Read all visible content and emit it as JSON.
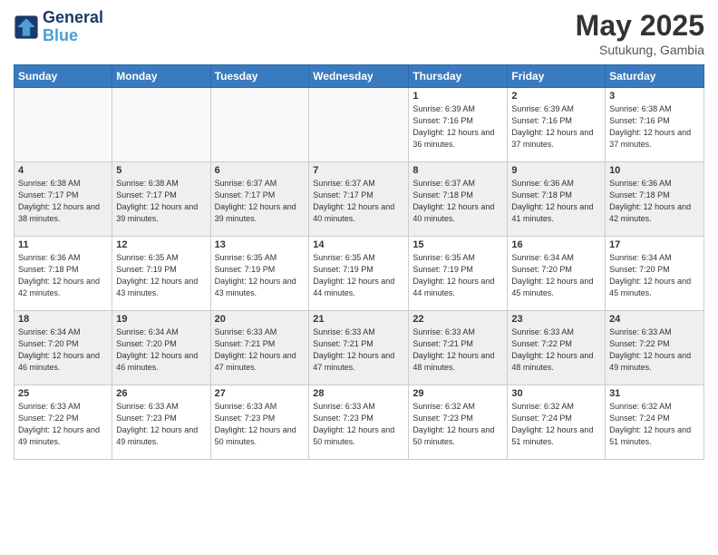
{
  "logo": {
    "line1": "General",
    "line2": "Blue"
  },
  "title": {
    "month": "May 2025",
    "location": "Sutukung, Gambia"
  },
  "weekdays": [
    "Sunday",
    "Monday",
    "Tuesday",
    "Wednesday",
    "Thursday",
    "Friday",
    "Saturday"
  ],
  "weeks": [
    [
      {
        "day": "",
        "sunrise": "",
        "sunset": "",
        "daylight": "",
        "empty": true
      },
      {
        "day": "",
        "sunrise": "",
        "sunset": "",
        "daylight": "",
        "empty": true
      },
      {
        "day": "",
        "sunrise": "",
        "sunset": "",
        "daylight": "",
        "empty": true
      },
      {
        "day": "",
        "sunrise": "",
        "sunset": "",
        "daylight": "",
        "empty": true
      },
      {
        "day": "1",
        "sunrise": "6:39 AM",
        "sunset": "7:16 PM",
        "daylight": "12 hours and 36 minutes."
      },
      {
        "day": "2",
        "sunrise": "6:39 AM",
        "sunset": "7:16 PM",
        "daylight": "12 hours and 37 minutes."
      },
      {
        "day": "3",
        "sunrise": "6:38 AM",
        "sunset": "7:16 PM",
        "daylight": "12 hours and 37 minutes."
      }
    ],
    [
      {
        "day": "4",
        "sunrise": "6:38 AM",
        "sunset": "7:17 PM",
        "daylight": "12 hours and 38 minutes."
      },
      {
        "day": "5",
        "sunrise": "6:38 AM",
        "sunset": "7:17 PM",
        "daylight": "12 hours and 39 minutes."
      },
      {
        "day": "6",
        "sunrise": "6:37 AM",
        "sunset": "7:17 PM",
        "daylight": "12 hours and 39 minutes."
      },
      {
        "day": "7",
        "sunrise": "6:37 AM",
        "sunset": "7:17 PM",
        "daylight": "12 hours and 40 minutes."
      },
      {
        "day": "8",
        "sunrise": "6:37 AM",
        "sunset": "7:18 PM",
        "daylight": "12 hours and 40 minutes."
      },
      {
        "day": "9",
        "sunrise": "6:36 AM",
        "sunset": "7:18 PM",
        "daylight": "12 hours and 41 minutes."
      },
      {
        "day": "10",
        "sunrise": "6:36 AM",
        "sunset": "7:18 PM",
        "daylight": "12 hours and 42 minutes."
      }
    ],
    [
      {
        "day": "11",
        "sunrise": "6:36 AM",
        "sunset": "7:18 PM",
        "daylight": "12 hours and 42 minutes."
      },
      {
        "day": "12",
        "sunrise": "6:35 AM",
        "sunset": "7:19 PM",
        "daylight": "12 hours and 43 minutes."
      },
      {
        "day": "13",
        "sunrise": "6:35 AM",
        "sunset": "7:19 PM",
        "daylight": "12 hours and 43 minutes."
      },
      {
        "day": "14",
        "sunrise": "6:35 AM",
        "sunset": "7:19 PM",
        "daylight": "12 hours and 44 minutes."
      },
      {
        "day": "15",
        "sunrise": "6:35 AM",
        "sunset": "7:19 PM",
        "daylight": "12 hours and 44 minutes."
      },
      {
        "day": "16",
        "sunrise": "6:34 AM",
        "sunset": "7:20 PM",
        "daylight": "12 hours and 45 minutes."
      },
      {
        "day": "17",
        "sunrise": "6:34 AM",
        "sunset": "7:20 PM",
        "daylight": "12 hours and 45 minutes."
      }
    ],
    [
      {
        "day": "18",
        "sunrise": "6:34 AM",
        "sunset": "7:20 PM",
        "daylight": "12 hours and 46 minutes."
      },
      {
        "day": "19",
        "sunrise": "6:34 AM",
        "sunset": "7:20 PM",
        "daylight": "12 hours and 46 minutes."
      },
      {
        "day": "20",
        "sunrise": "6:33 AM",
        "sunset": "7:21 PM",
        "daylight": "12 hours and 47 minutes."
      },
      {
        "day": "21",
        "sunrise": "6:33 AM",
        "sunset": "7:21 PM",
        "daylight": "12 hours and 47 minutes."
      },
      {
        "day": "22",
        "sunrise": "6:33 AM",
        "sunset": "7:21 PM",
        "daylight": "12 hours and 48 minutes."
      },
      {
        "day": "23",
        "sunrise": "6:33 AM",
        "sunset": "7:22 PM",
        "daylight": "12 hours and 48 minutes."
      },
      {
        "day": "24",
        "sunrise": "6:33 AM",
        "sunset": "7:22 PM",
        "daylight": "12 hours and 49 minutes."
      }
    ],
    [
      {
        "day": "25",
        "sunrise": "6:33 AM",
        "sunset": "7:22 PM",
        "daylight": "12 hours and 49 minutes."
      },
      {
        "day": "26",
        "sunrise": "6:33 AM",
        "sunset": "7:23 PM",
        "daylight": "12 hours and 49 minutes."
      },
      {
        "day": "27",
        "sunrise": "6:33 AM",
        "sunset": "7:23 PM",
        "daylight": "12 hours and 50 minutes."
      },
      {
        "day": "28",
        "sunrise": "6:33 AM",
        "sunset": "7:23 PM",
        "daylight": "12 hours and 50 minutes."
      },
      {
        "day": "29",
        "sunrise": "6:32 AM",
        "sunset": "7:23 PM",
        "daylight": "12 hours and 50 minutes."
      },
      {
        "day": "30",
        "sunrise": "6:32 AM",
        "sunset": "7:24 PM",
        "daylight": "12 hours and 51 minutes."
      },
      {
        "day": "31",
        "sunrise": "6:32 AM",
        "sunset": "7:24 PM",
        "daylight": "12 hours and 51 minutes."
      }
    ]
  ]
}
